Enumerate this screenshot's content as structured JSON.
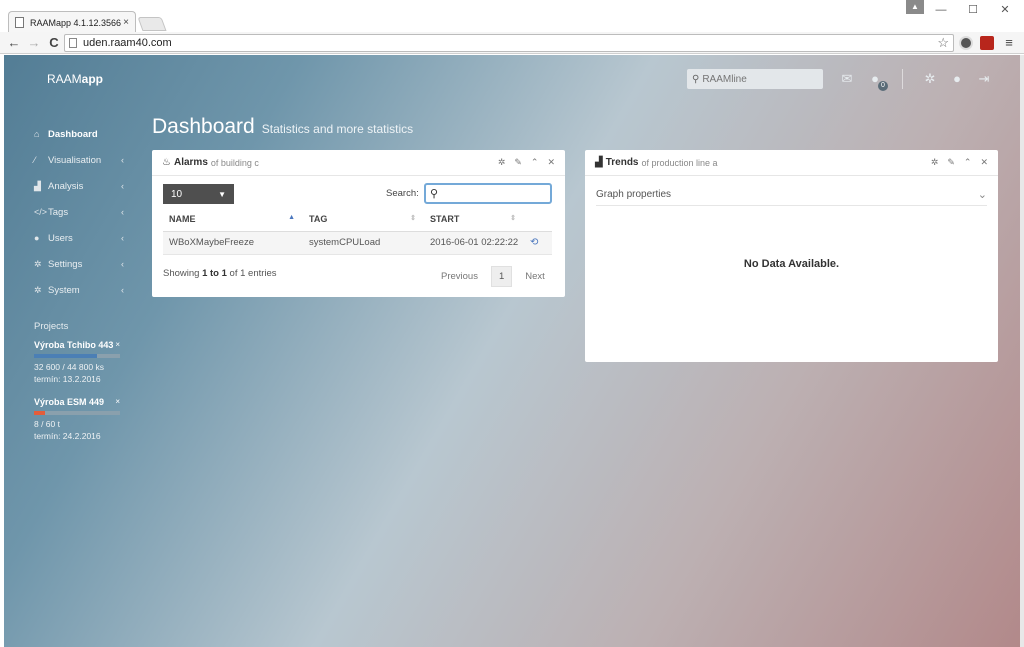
{
  "browser": {
    "tab_title": "RAAMapp 4.1.12.3566",
    "tab_close": "×",
    "url": "uden.raam40.com",
    "back": "←",
    "forward": "→",
    "reload": "C",
    "star": "☆",
    "menu": "≡",
    "win_min": "—",
    "win_max": "☐",
    "win_close": "✕"
  },
  "app": {
    "brand_prefix": "RAAM",
    "brand_suffix": "app",
    "search_placeholder": "RAAMline",
    "notification_count": "0"
  },
  "sidebar": {
    "items": [
      {
        "label": "Dashboard",
        "icon": "home-icon",
        "glyph": "⌂"
      },
      {
        "label": "Visualisation",
        "icon": "magic-wand-icon",
        "glyph": "⁄"
      },
      {
        "label": "Analysis",
        "icon": "area-chart-icon",
        "glyph": "▟"
      },
      {
        "label": "Tags",
        "icon": "code-icon",
        "glyph": "</>"
      },
      {
        "label": "Users",
        "icon": "user-icon",
        "glyph": "●"
      },
      {
        "label": "Settings",
        "icon": "gear-icon",
        "glyph": "✲"
      },
      {
        "label": "System",
        "icon": "gears-icon",
        "glyph": "✲"
      }
    ],
    "chevron": "‹"
  },
  "projects": {
    "heading": "Projects",
    "list": [
      {
        "name": "Výroba Tchibo 443",
        "close": "×",
        "progress": 0.73,
        "bar_color": "#4b7fb5",
        "amount": "32 600 / 44 800 ks",
        "term": "termín: 13.2.2016"
      },
      {
        "name": "Výroba ESM 449",
        "close": "×",
        "progress": 0.13,
        "bar_color": "#e35d3b",
        "amount": "8 / 60 t",
        "term": "termín: 24.2.2016"
      }
    ]
  },
  "page": {
    "title": "Dashboard",
    "subtitle": "Statistics and more statistics"
  },
  "alarms": {
    "title": "Alarms",
    "subtitle": "of building c",
    "page_length": "10",
    "search_label": "Search:",
    "columns": [
      "NAME",
      "TAG",
      "START"
    ],
    "rows": [
      {
        "name": "WBoXMaybeFreeze",
        "tag": "systemCPULoad",
        "start": "2016-06-01 02:22:22"
      }
    ],
    "showing_prefix": "Showing",
    "showing_range": "1 to 1",
    "showing_suffix": "of 1 entries",
    "previous": "Previous",
    "current_page": "1",
    "next": "Next"
  },
  "trends": {
    "title": "Trends",
    "subtitle": "of production line a",
    "graph_properties": "Graph properties",
    "no_data": "No Data Available."
  }
}
